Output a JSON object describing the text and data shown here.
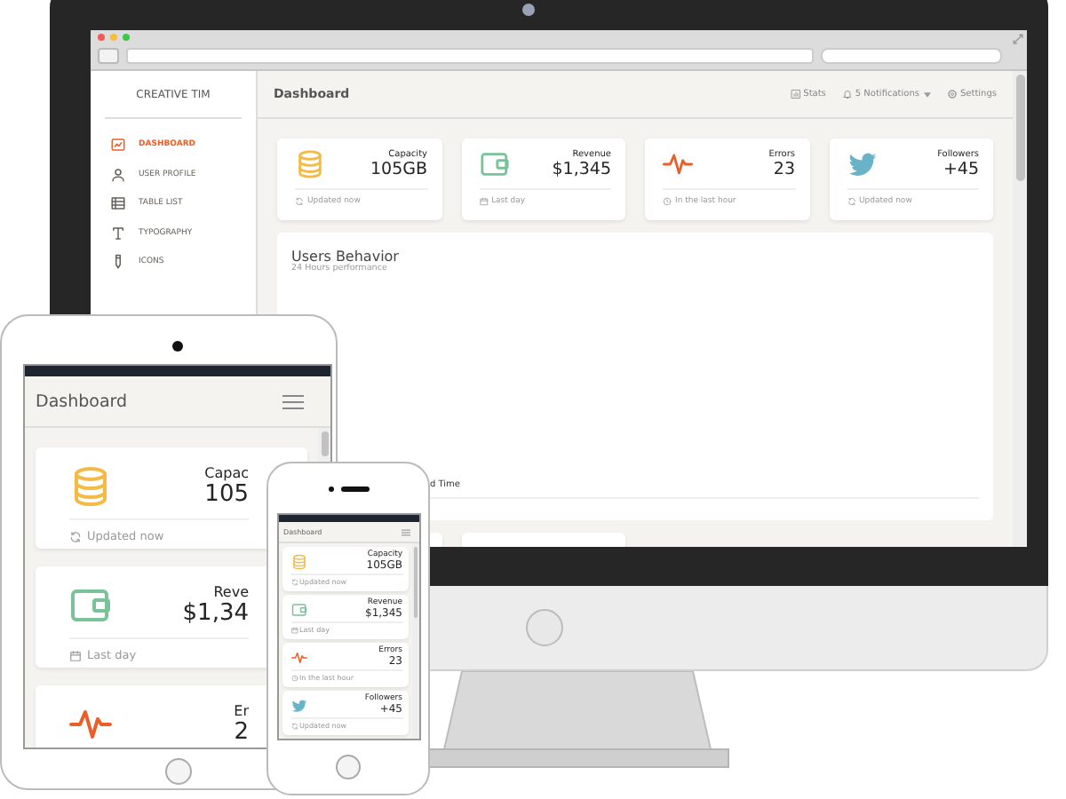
{
  "monitor": {
    "sidebar": {
      "brand": "CREATIVE TIM",
      "items": [
        {
          "label": "DASHBOARD",
          "selected": true
        },
        {
          "label": "USER PROFILE",
          "selected": false
        },
        {
          "label": "TABLE LIST",
          "selected": false
        },
        {
          "label": "TYPOGRAPHY",
          "selected": false
        },
        {
          "label": "ICONS",
          "selected": false
        }
      ]
    },
    "header": {
      "title": "Dashboard",
      "actions": [
        {
          "label": "Stats",
          "dropdown": false
        },
        {
          "label": "5 Notifications",
          "dropdown": true
        },
        {
          "label": "Settings",
          "dropdown": false
        }
      ]
    },
    "stats": [
      {
        "kind": "database",
        "title": "Capacity",
        "value": "105GB",
        "footer": "Updated now"
      },
      {
        "kind": "wallet",
        "title": "Revenue",
        "value": "$1,345",
        "footer": "Last day"
      },
      {
        "kind": "pulse",
        "title": "Errors",
        "value": "23",
        "footer": "In the last hour"
      },
      {
        "kind": "bird",
        "title": "Followers",
        "value": "+45",
        "footer": "Updated now"
      }
    ],
    "chart_card": {
      "title": "Users Behavior",
      "subtitle": "24 Hours performance",
      "legend": "d Time"
    }
  },
  "tablet": {
    "title": "Dashboard",
    "stats": [
      {
        "kind": "database",
        "title": "Capac",
        "value": "105",
        "footer": "Updated now"
      },
      {
        "kind": "wallet",
        "title": "Reve",
        "value": "$1,34",
        "footer": "Last day"
      },
      {
        "kind": "pulse",
        "title": "Er",
        "value": "2"
      }
    ]
  },
  "phone": {
    "title": "Dashboard",
    "stats": [
      {
        "kind": "database",
        "title": "Capacity",
        "value": "105GB",
        "footer": "Updated now"
      },
      {
        "kind": "wallet",
        "title": "Revenue",
        "value": "$1,345",
        "footer": "Last day"
      },
      {
        "kind": "pulse",
        "title": "Errors",
        "value": "23",
        "footer": "In the last hour"
      },
      {
        "kind": "bird",
        "title": "Followers",
        "value": "+45",
        "footer": "Updated now"
      }
    ]
  }
}
